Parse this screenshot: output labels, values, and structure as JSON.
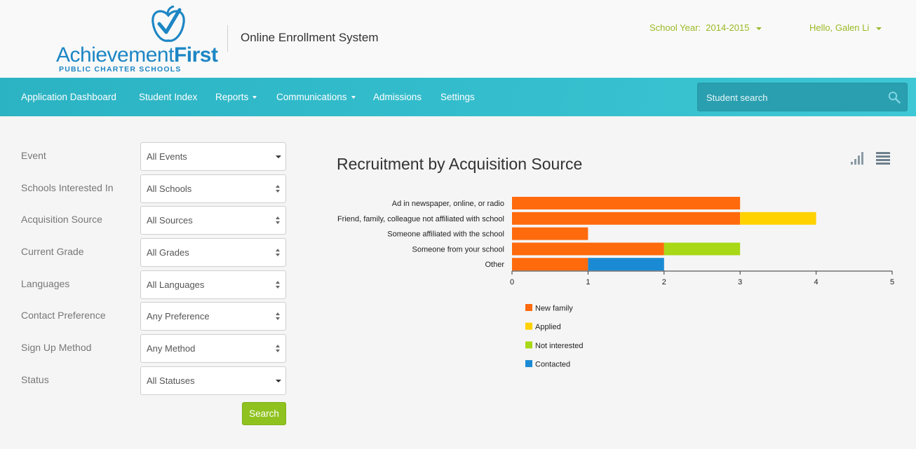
{
  "brand": {
    "logo_text_regular": "Achievement",
    "logo_text_bold": "First",
    "logo_subtext": "PUBLIC CHARTER SCHOOLS",
    "app_title": "Online Enrollment System",
    "accent_color": "#1d86c4"
  },
  "header": {
    "school_year_label": "School Year:",
    "school_year_value": "2014-2015",
    "greeting": "Hello, Galen Li",
    "link_color": "#9ab925"
  },
  "nav": {
    "items": [
      {
        "label": "Application Dashboard",
        "has_dropdown": false
      },
      {
        "label": "Student Index",
        "has_dropdown": false
      },
      {
        "label": "Reports",
        "has_dropdown": true
      },
      {
        "label": "Communications",
        "has_dropdown": true
      },
      {
        "label": "Admissions",
        "has_dropdown": false
      },
      {
        "label": "Settings",
        "has_dropdown": false
      }
    ],
    "search_placeholder": "Student search",
    "bar_color": "#35bfce"
  },
  "filters": [
    {
      "label": "Event",
      "value": "All Events",
      "control": "dropdown"
    },
    {
      "label": "Schools Interested In",
      "value": "All Schools",
      "control": "select"
    },
    {
      "label": "Acquisition Source",
      "value": "All Sources",
      "control": "select"
    },
    {
      "label": "Current Grade",
      "value": "All Grades",
      "control": "select"
    },
    {
      "label": "Languages",
      "value": "All Languages",
      "control": "select"
    },
    {
      "label": "Contact Preference",
      "value": "Any Preference",
      "control": "select"
    },
    {
      "label": "Sign Up Method",
      "value": "Any Method",
      "control": "select"
    },
    {
      "label": "Status",
      "value": "All Statuses",
      "control": "dropdown"
    }
  ],
  "search_button_label": "Search",
  "view_icons": [
    "bar-chart-icon",
    "table-list-icon"
  ],
  "chart_data": {
    "type": "bar",
    "orientation": "horizontal",
    "stacked": true,
    "title": "Recruitment by Acquisition Source",
    "categories": [
      "Ad in newspaper, online, or radio",
      "Friend, family, colleague not affiliated with school",
      "Someone affiliated with the school",
      "Someone from your school",
      "Other"
    ],
    "series": [
      {
        "name": "New family",
        "color": "#ff6a0d",
        "values": [
          3,
          3,
          1,
          2,
          1
        ]
      },
      {
        "name": "Applied",
        "color": "#ffd200",
        "values": [
          0,
          1,
          0,
          0,
          0
        ]
      },
      {
        "name": "Not interested",
        "color": "#a8d816",
        "values": [
          0,
          0,
          0,
          1,
          0
        ]
      },
      {
        "name": "Contacted",
        "color": "#1a8ad4",
        "values": [
          0,
          0,
          0,
          0,
          1
        ]
      }
    ],
    "xlim": [
      0,
      5
    ],
    "xticks": [
      0,
      1,
      2,
      3,
      4,
      5
    ],
    "grid": false,
    "legend_position": "bottom-left"
  }
}
